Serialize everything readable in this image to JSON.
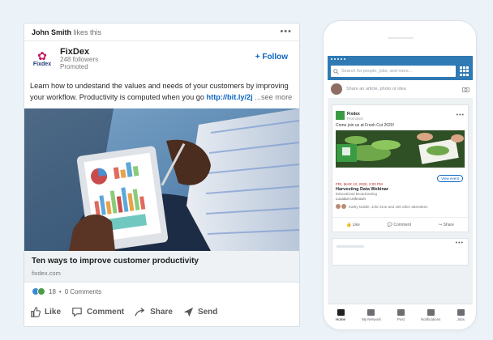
{
  "post": {
    "activity_actor": "John Smith",
    "activity_verb": "likes this",
    "company": {
      "name": "FixDex",
      "logo_text": "Fixdex",
      "followers": "248 followers",
      "promoted": "Promoted"
    },
    "follow_label": "+ Follow",
    "text_before_link": "Learn how to undestand the values and needs of your customers by improving your workflow. Productivity is computed when you go ",
    "link": "http://bit.ly/2j",
    "see_more": "...see more",
    "article": {
      "title": "Ten ways to improve customer productivity",
      "domain": "fixdex.com"
    },
    "social": {
      "reactions": "18",
      "separator": "•",
      "comments": "0 Comments"
    },
    "actions": [
      {
        "label": "Like",
        "icon": "thumbs-up-icon"
      },
      {
        "label": "Comment",
        "icon": "comment-icon"
      },
      {
        "label": "Share",
        "icon": "share-icon"
      },
      {
        "label": "Send",
        "icon": "send-icon"
      }
    ],
    "colors": {
      "link": "#0a66c2",
      "logo_mark": "#c2185b",
      "logo_text": "#1d3c73"
    }
  },
  "phone": {
    "search_placeholder": "Search for people, jobs, and more...",
    "share_prompt": "Share an article, photo or idea",
    "card": {
      "org": "Fixdex",
      "org_sub": "Promoted",
      "intro": "Come join us at Fresh Cut 2020!",
      "event_date": "FRI, MAR 13, 2020, 2:00 PM",
      "event_title": "Harvesting Data Webinar",
      "event_sub": "Educational Broadcasting",
      "event_location": "Location Unknown",
      "attendees": "Kathy Nobile, John Doe and 100 other attendees",
      "button": "View event",
      "actions": [
        "Like",
        "Comment",
        "Share"
      ]
    },
    "tabs": [
      {
        "label": "Home",
        "icon": "home-icon"
      },
      {
        "label": "My Network",
        "icon": "network-icon"
      },
      {
        "label": "Post",
        "icon": "post-icon"
      },
      {
        "label": "Notifications",
        "icon": "bell-icon"
      },
      {
        "label": "Jobs",
        "icon": "briefcase-icon"
      }
    ],
    "colors": {
      "app_bar": "#2f7ab5",
      "brand_green": "#3a9b45"
    }
  }
}
